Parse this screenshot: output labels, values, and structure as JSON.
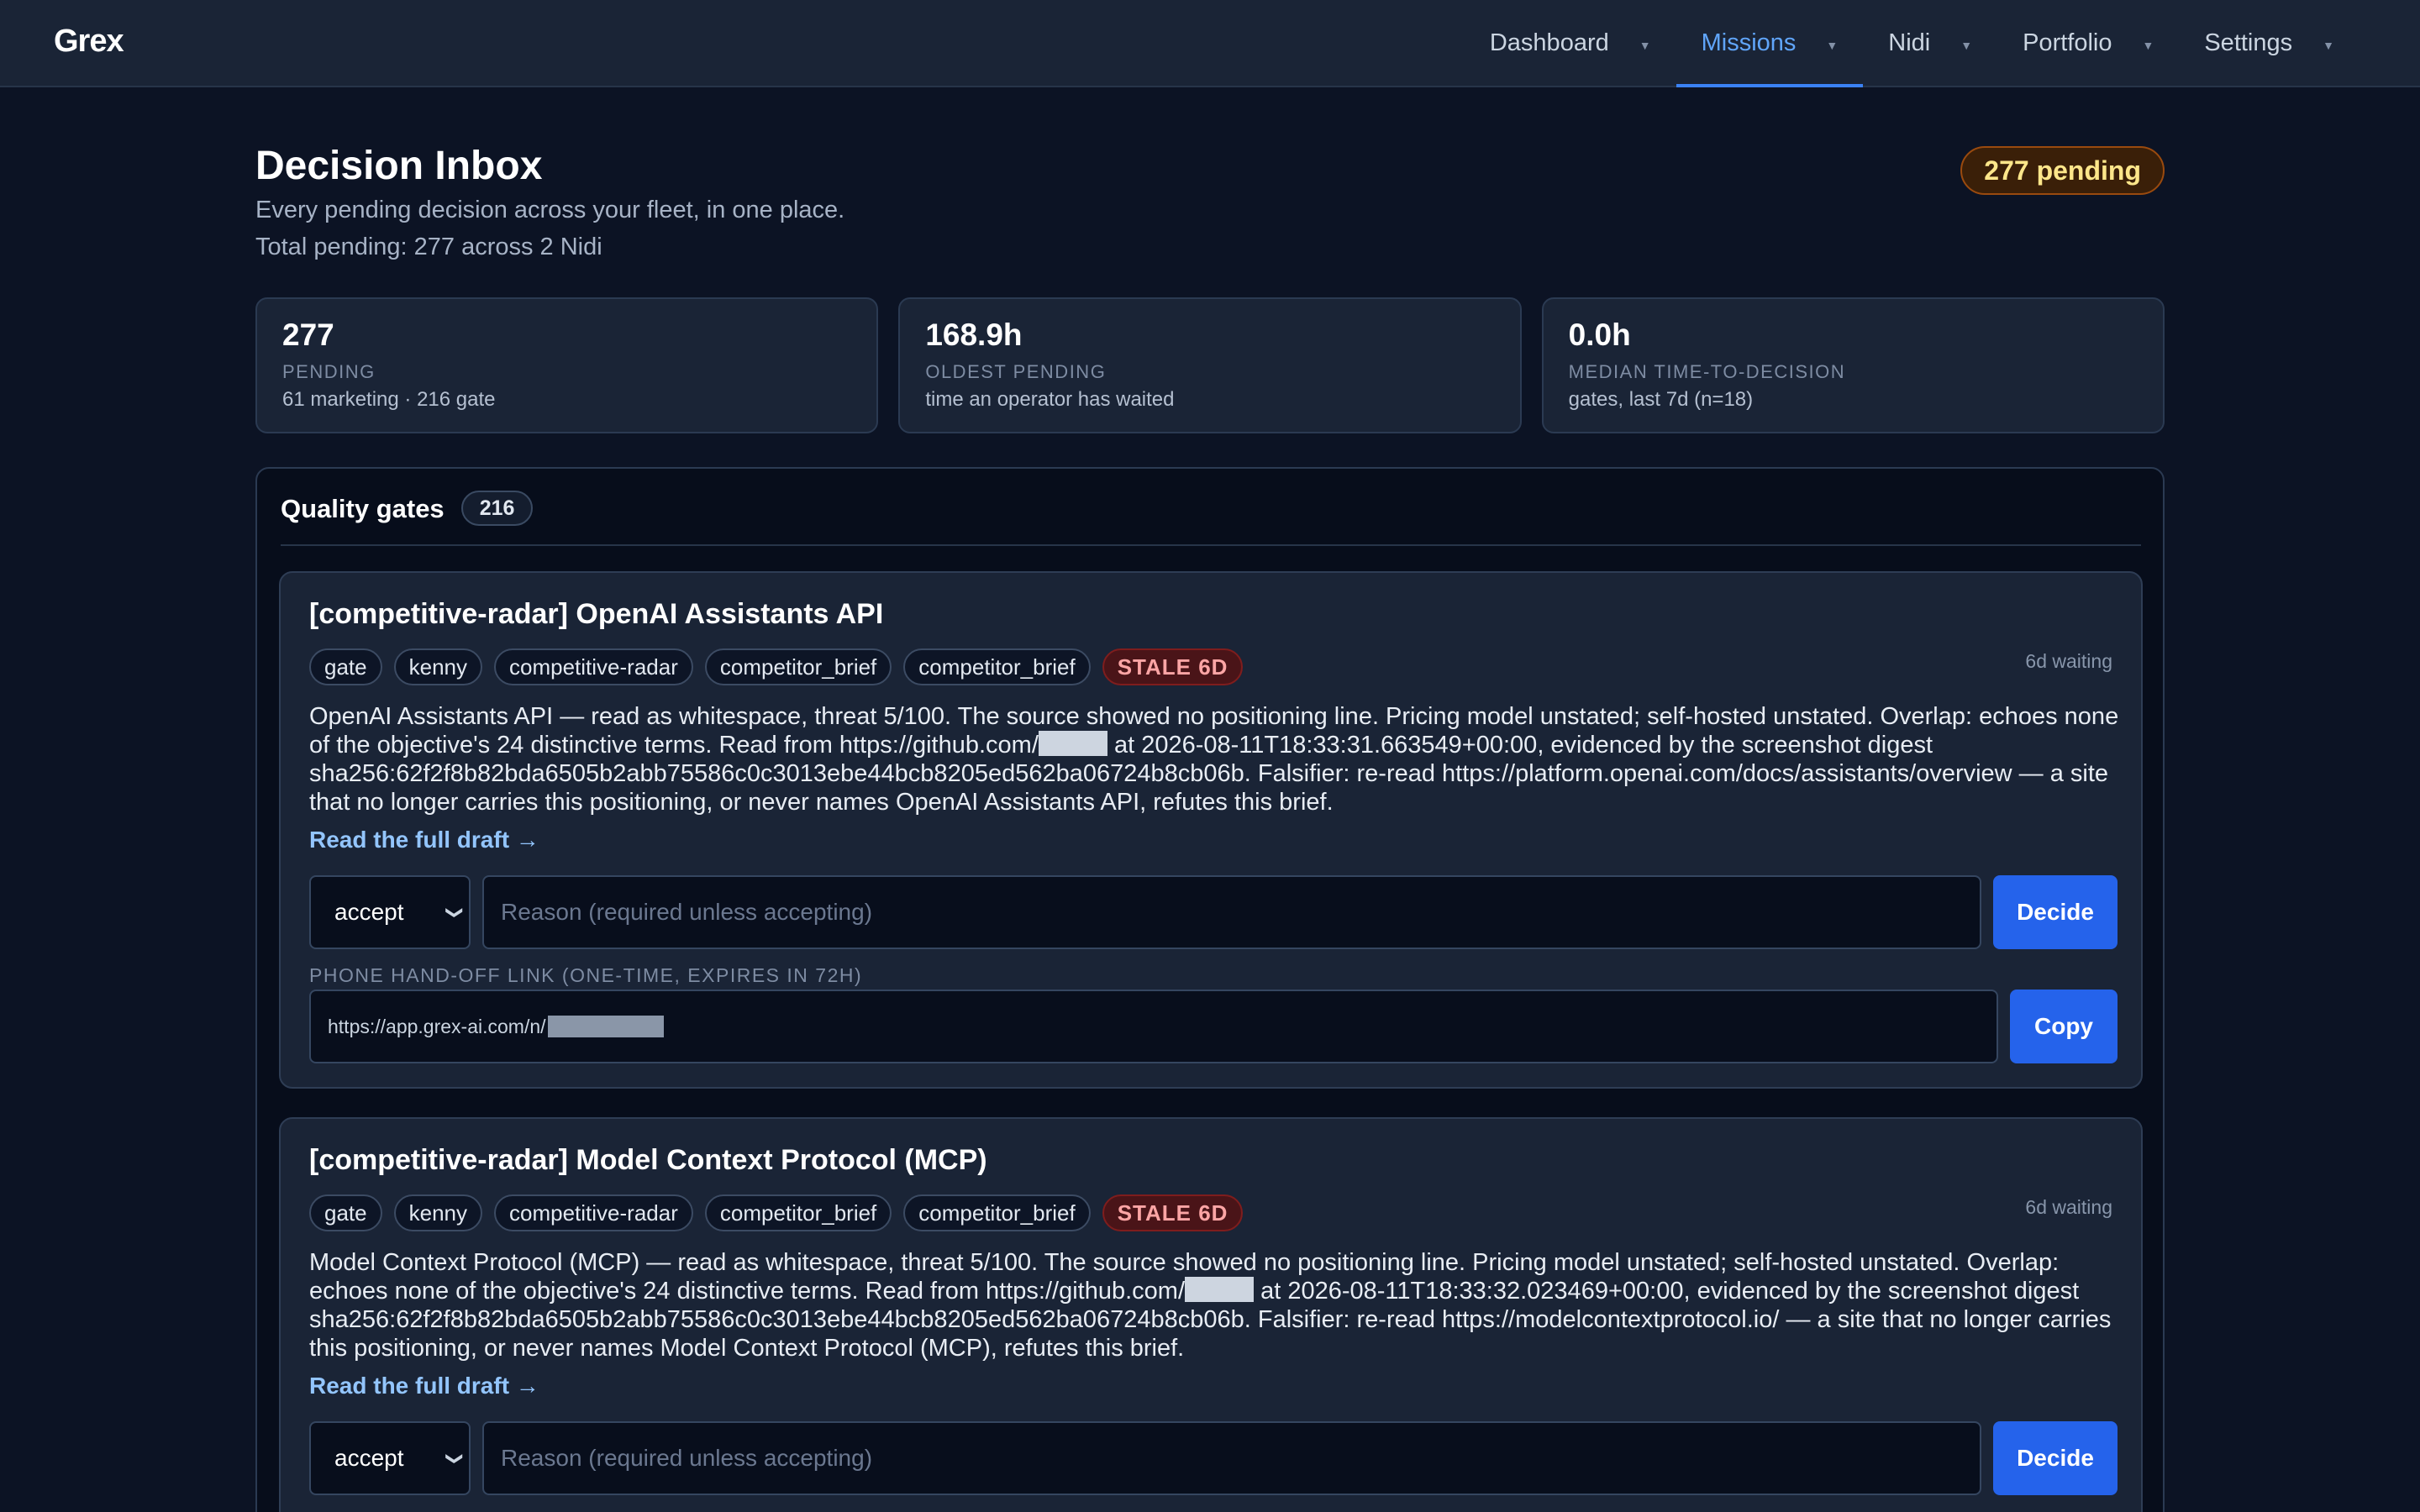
{
  "app": {
    "brand": "Grex",
    "nav": [
      {
        "label": "Dashboard",
        "active": false
      },
      {
        "label": "Missions",
        "active": true
      },
      {
        "label": "Nidi",
        "active": false
      },
      {
        "label": "Portfolio",
        "active": false
      },
      {
        "label": "Settings",
        "active": false
      }
    ],
    "caret_icon": "chevron-down-icon"
  },
  "header": {
    "title": "Decision Inbox",
    "subtitle": "Every pending decision across your fleet, in one place.",
    "total": "Total pending: 277 across 2 Nidi",
    "pending_badge": "277 pending"
  },
  "stats": [
    {
      "value": "277",
      "label": "PENDING",
      "sub": "61 marketing · 216 gate"
    },
    {
      "value": "168.9h",
      "label": "OLDEST PENDING",
      "sub": "time an operator has waited"
    },
    {
      "value": "0.0h",
      "label": "MEDIAN TIME-TO-DECISION",
      "sub": "gates, last 7d (n=18)"
    }
  ],
  "section": {
    "title": "Quality gates",
    "count": "216"
  },
  "cards": [
    {
      "title": "[competitive-radar] OpenAI Assistants API",
      "waiting": "6d waiting",
      "tags": [
        "gate",
        "kenny",
        "competitive-radar",
        "competitor_brief",
        "competitor_brief"
      ],
      "stale": "STALE 6D",
      "desc_a": "OpenAI Assistants API — read as whitespace, threat 5/100. The source showed no positioning line. Pricing model unstated; self-hosted unstated. Overlap: echoes none of the objective's 24 distinctive terms. Read from https://github.com/",
      "desc_b": " at 2026-08-11T18:33:31.663549+00:00, evidenced by the screenshot digest sha256:62f2f8b82bda6505b2abb75586c0c3013ebe44bcb8205ed562ba06724b8cb06b. Falsifier: re-read https://platform.openai.com/docs/assistants/overview — a site that no longer carries this positioning, or never names OpenAI Assistants API, refutes this brief.",
      "link": "Read the full draft →",
      "select": "accept",
      "reason_placeholder": "Reason (required unless accepting)",
      "decide": "Decide",
      "handoff_label": "PHONE HAND-OFF LINK (ONE-TIME, EXPIRES IN 72H)",
      "handoff_url": "https://app.grex-ai.com/n/",
      "copy": "Copy"
    },
    {
      "title": "[competitive-radar] Model Context Protocol (MCP)",
      "waiting": "6d waiting",
      "tags": [
        "gate",
        "kenny",
        "competitive-radar",
        "competitor_brief",
        "competitor_brief"
      ],
      "stale": "STALE 6D",
      "desc_a": "Model Context Protocol (MCP) — read as whitespace, threat 5/100. The source showed no positioning line. Pricing model unstated; self-hosted unstated. Overlap: echoes none of the objective's 24 distinctive terms. Read from https://github.com/",
      "desc_b": " at 2026-08-11T18:33:32.023469+00:00, evidenced by the screenshot digest sha256:62f2f8b82bda6505b2abb75586c0c3013ebe44bcb8205ed562ba06724b8cb06b. Falsifier: re-read https://modelcontextprotocol.io/ — a site that no longer carries this positioning, or never names Model Context Protocol (MCP), refutes this brief.",
      "link": "Read the full draft →",
      "select": "accept",
      "reason_placeholder": "Reason (required unless accepting)",
      "decide": "Decide"
    }
  ]
}
